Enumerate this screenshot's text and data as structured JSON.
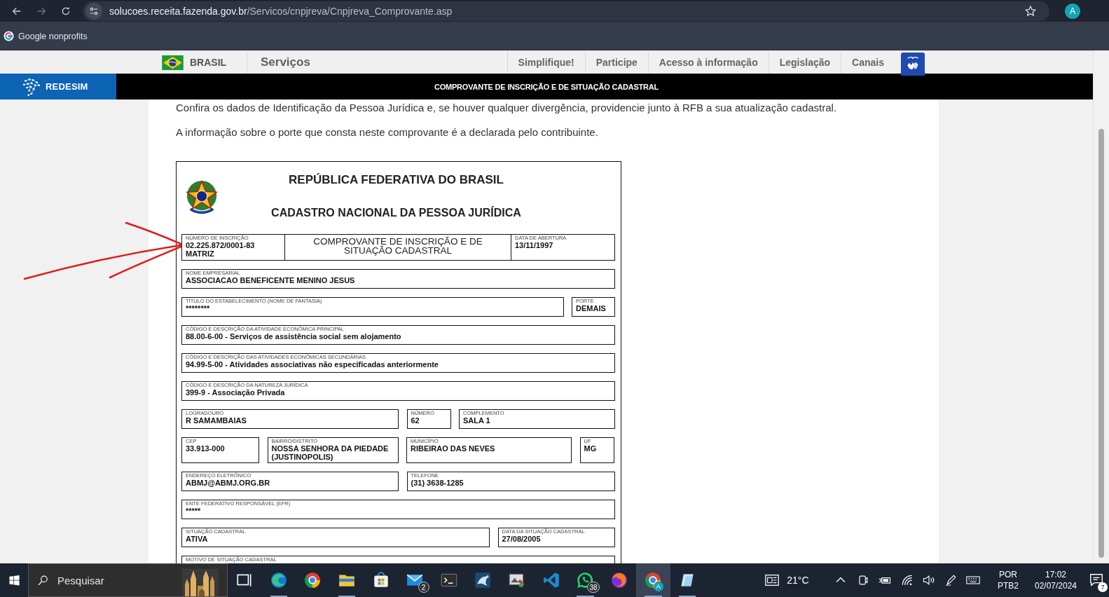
{
  "browser": {
    "url_host": "solucoes.receita.fazenda.gov.br",
    "url_path": "/Servicos/cnpjreva/Cnpjreva_Comprovante.asp",
    "profile": "A",
    "bookmarks": [
      {
        "label": "Google nonprofits"
      }
    ]
  },
  "gov_bar": {
    "brand": "BRASIL",
    "services": "Serviços",
    "links": [
      "Simplifique!",
      "Participe",
      "Acesso à informação",
      "Legislação",
      "Canais"
    ]
  },
  "header": {
    "logo": "REDESIM",
    "title": "COMPROVANTE DE INSCRIÇÃO E DE SITUAÇÃO CADASTRAL"
  },
  "intro": [
    "Confira os dados de Identificação da Pessoa Jurídica e, se houver qualquer divergência, providencie junto à RFB a sua atualização cadastral.",
    "A informação sobre o porte que consta neste comprovante é a declarada pelo contribuinte."
  ],
  "document": {
    "title": "REPÚBLICA FEDERATIVA DO BRASIL",
    "subtitle": "CADASTRO NACIONAL DA PESSOA JURÍDICA",
    "rows": [
      [
        {
          "label": "NÚMERO DE INSCRIÇÃO",
          "lines": [
            "02.225.872/0001-83",
            "MATRIZ"
          ]
        },
        {
          "kind": "title",
          "text": "COMPROVANTE DE INSCRIÇÃO E DE SITUAÇÃO CADASTRAL"
        },
        {
          "label": "DATA DE ABERTURA",
          "lines": [
            "13/11/1997"
          ]
        }
      ],
      [
        {
          "label": "NOME EMPRESARIAL",
          "lines": [
            "ASSOCIACAO BENEFICENTE MENINO JESUS"
          ]
        }
      ],
      [
        {
          "label": "TÍTULO DO ESTABELECIMENTO (NOME DE FANTASIA)",
          "lines": [
            "********"
          ]
        },
        {
          "label": "PORTE",
          "lines": [
            "DEMAIS"
          ]
        }
      ],
      [
        {
          "label": "CÓDIGO E DESCRIÇÃO DA ATIVIDADE ECONÔMICA PRINCIPAL",
          "lines": [
            "88.00-6-00 - Serviços de assistência social sem alojamento"
          ]
        }
      ],
      [
        {
          "label": "CÓDIGO E DESCRIÇÃO DAS ATIVIDADES ECONÔMICAS SECUNDÁRIAS",
          "lines": [
            "94.99-5-00 - Atividades associativas não especificadas anteriormente"
          ]
        }
      ],
      [
        {
          "label": "CÓDIGO E DESCRIÇÃO DA NATUREZA JURÍDICA",
          "lines": [
            "399-9 - Associação Privada"
          ]
        }
      ],
      [
        {
          "label": "LOGRADOURO",
          "lines": [
            "R SAMAMBAIAS"
          ]
        },
        {
          "label": "NÚMERO",
          "lines": [
            "62"
          ]
        },
        {
          "label": "COMPLEMENTO",
          "lines": [
            "SALA 1"
          ]
        }
      ],
      [
        {
          "label": "CEP",
          "lines": [
            "33.913-000"
          ]
        },
        {
          "label": "BAIRRO/DISTRITO",
          "lines": [
            "NOSSA SENHORA DA PIEDADE",
            "(JUSTINOPOLIS)"
          ]
        },
        {
          "label": "MUNICÍPIO",
          "lines": [
            "RIBEIRAO DAS NEVES"
          ]
        },
        {
          "label": "UF",
          "lines": [
            "MG"
          ]
        }
      ],
      [
        {
          "label": "ENDEREÇO ELETRÔNICO",
          "lines": [
            "ABMJ@ABMJ.ORG.BR"
          ]
        },
        {
          "label": "TELEFONE",
          "lines": [
            "(31) 3638-1285"
          ]
        }
      ],
      [
        {
          "label": "ENTE FEDERATIVO RESPONSÁVEL (EFR)",
          "lines": [
            "*****"
          ]
        }
      ],
      [
        {
          "label": "SITUAÇÃO CADASTRAL",
          "lines": [
            "ATIVA"
          ]
        },
        {
          "label": "DATA DA SITUAÇÃO CADASTRAL",
          "lines": [
            "27/08/2005"
          ]
        }
      ],
      [
        {
          "label": "MOTIVO DE SITUAÇÃO CADASTRAL"
        }
      ]
    ]
  },
  "taskbar": {
    "search": {
      "placeholder": "Pesquisar"
    },
    "apps": [
      {
        "kind": "task-view",
        "running": false,
        "selected": false
      },
      {
        "kind": "edge",
        "running": true,
        "selected": false
      },
      {
        "kind": "chrome",
        "running": false,
        "selected": false
      },
      {
        "kind": "explorer",
        "running": true,
        "selected": false
      },
      {
        "kind": "store",
        "running": false,
        "selected": false
      },
      {
        "kind": "mail",
        "badge": "2",
        "running": false,
        "selected": false
      },
      {
        "kind": "terminal",
        "running": false,
        "selected": false
      },
      {
        "kind": "dolphin",
        "running": false,
        "selected": false
      },
      {
        "kind": "image-tool",
        "running": false,
        "selected": false
      },
      {
        "kind": "code",
        "running": false,
        "selected": false
      },
      {
        "kind": "chat",
        "badge": "38",
        "running": true,
        "selected": false
      },
      {
        "kind": "firefox",
        "running": false,
        "selected": false
      },
      {
        "kind": "chrome-profile",
        "badge": "A",
        "running": true,
        "selected": true
      },
      {
        "kind": "notepad",
        "running": true,
        "selected": false
      }
    ],
    "weather": "21°C",
    "language": [
      "POR",
      "PTB2"
    ],
    "time": "17:02",
    "date": "02/07/2024",
    "notifications": "7"
  }
}
